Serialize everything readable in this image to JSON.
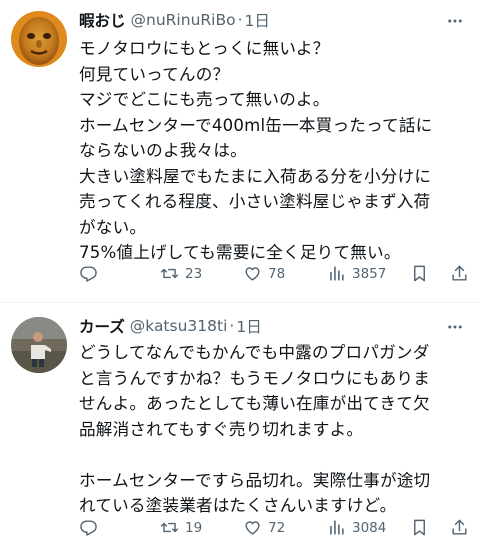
{
  "tweets": [
    {
      "display_name": "暇おじ",
      "handle": "@nuRinuRiBo",
      "separator": "·",
      "time": "1日",
      "lines": [
        "モノタロウにもとっくに無いよ？",
        "何見ていってんの？",
        "マジでどこにも売って無いのよ。",
        "ホームセンターで400ml缶一本買ったって話に",
        "ならないのよ我々は。",
        "大きい塗料屋でもたまに入荷ある分を小分けに",
        "売ってくれる程度、小さい塗料屋じゃまず入荷",
        "がない。",
        "75%値上げしても需要に全く足りて無い。"
      ],
      "replies": "",
      "retweets": "23",
      "likes": "78",
      "views": "3857"
    },
    {
      "display_name": "カーズ",
      "handle": "@katsu318ti",
      "separator": "·",
      "time": "1日",
      "lines": [
        "どうしてなんでもかんでも中露のプロパガンダ",
        "と言うんですかね？もうモノタロウにもありま",
        "せんよ。あったとしても薄い在庫が出てきて欠",
        "品解消されてもすぐ売り切れますよ。",
        "",
        "ホームセンターですら品切れ。実際仕事が途切",
        "れている塗装業者はたくさんいますけど。"
      ],
      "replies": "",
      "retweets": "19",
      "likes": "72",
      "views": "3084"
    }
  ],
  "colors": {
    "text": "#0f1419",
    "secondary": "#536471",
    "divider": "#eff3f4"
  },
  "icons": [
    "more-icon",
    "reply-icon",
    "retweet-icon",
    "like-icon",
    "views-icon",
    "bookmark-icon",
    "share-icon"
  ]
}
